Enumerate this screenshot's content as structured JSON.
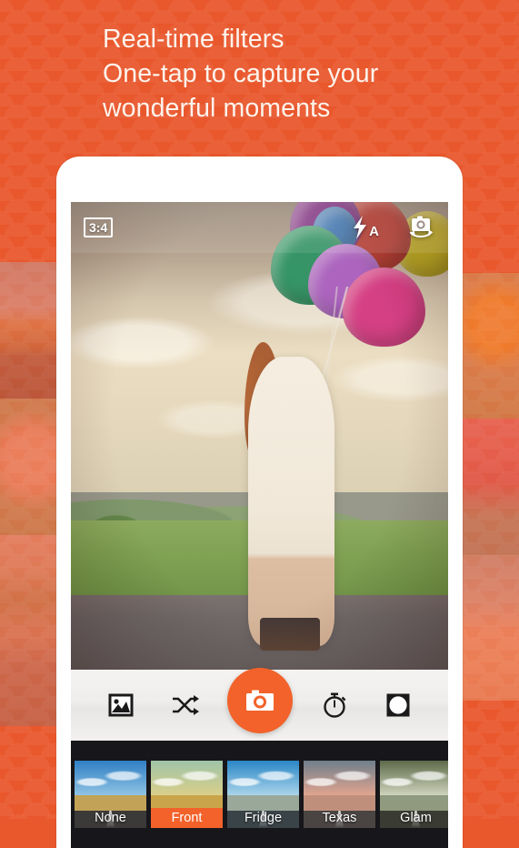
{
  "theme": {
    "brand_orange": "#E9572C",
    "accent_orange": "#F2622A",
    "headline_color": "#FCF3EC",
    "strip_background": "#17161a"
  },
  "headline": {
    "line1": "Real-time filters",
    "line2": "One-tap to capture your",
    "line3": "wonderful moments"
  },
  "camera": {
    "topbar": {
      "aspect_ratio": "3:4",
      "flash_mode_letter": "A",
      "flash_icon": "flash-auto-icon",
      "switch_icon": "switch-camera-icon"
    },
    "toolbar": {
      "gallery_icon": "gallery-icon",
      "shuffle_icon": "shuffle-icon",
      "shutter_icon": "camera-icon",
      "timer_icon": "timer-icon",
      "vignette_icon": "vignette-icon"
    },
    "filters": [
      {
        "label": "None",
        "selected": false,
        "sky": "#2f7fc4",
        "sky2": "#8fc3e4",
        "ground": "#c2a256",
        "tar": "#3c3a38"
      },
      {
        "label": "Front",
        "selected": true,
        "sky": "#9fc4a8",
        "sky2": "#d9cf8a",
        "ground": "#c9a44a",
        "tar": "#5a5347"
      },
      {
        "label": "Fridge",
        "selected": false,
        "sky": "#2a86c6",
        "sky2": "#a9d4ea",
        "ground": "#9aa89a",
        "tar": "#3a4347"
      },
      {
        "label": "Texas",
        "selected": false,
        "sky": "#6f7f8c",
        "sky2": "#e0a48e",
        "ground": "#c08f7c",
        "tar": "#4a4543"
      },
      {
        "label": "Glam",
        "selected": false,
        "sky": "#5c6b4a",
        "sky2": "#cfd3bc",
        "ground": "#8f9a7e",
        "tar": "#3a3c33"
      },
      {
        "label": "",
        "selected": false,
        "sky": "#2f7fc4",
        "sky2": "#8fc3e4",
        "ground": "#c2a256",
        "tar": "#3c3a38",
        "partial": true
      }
    ]
  }
}
